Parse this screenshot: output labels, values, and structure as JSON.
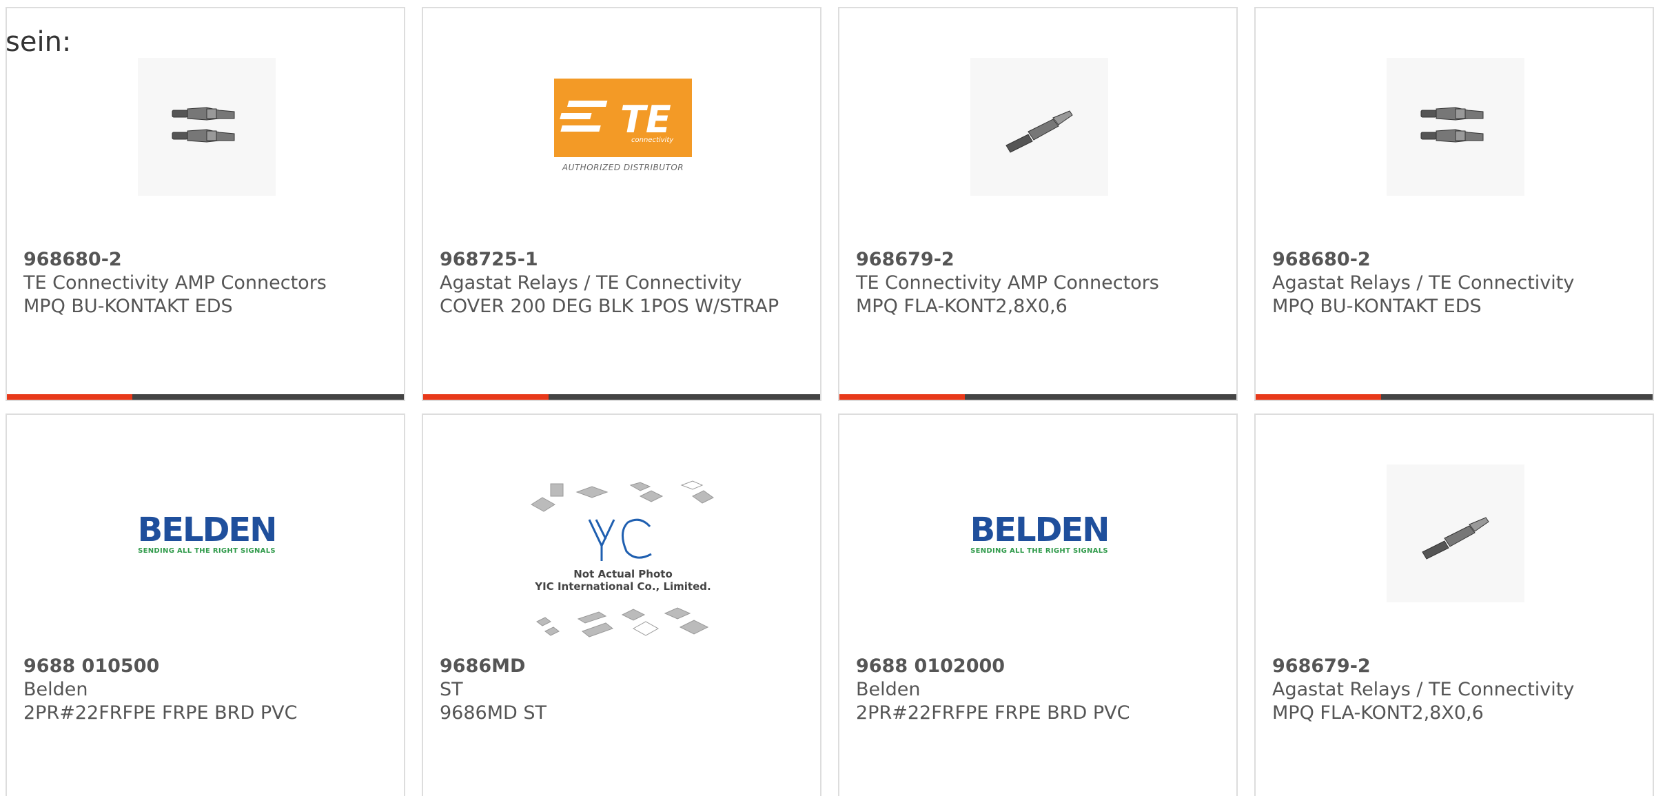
{
  "lead_text": "sein:",
  "colors": {
    "accent_red": "#e8391a",
    "bar_dark": "#444444",
    "te_orange": "#f39a26",
    "belden_blue": "#1f4f9c",
    "belden_green": "#2f9a4a"
  },
  "products": [
    {
      "part_number": "968680-2",
      "manufacturer": "TE Connectivity AMP Connectors",
      "description": "MPQ BU-KONTAKT EDS",
      "image": "socket-contact-photo"
    },
    {
      "part_number": "968725-1",
      "manufacturer": "Agastat Relays / TE Connectivity",
      "description": "COVER 200 DEG BLK 1POS W/STRAP",
      "image": "te-connectivity-logo",
      "logo_sub": "connectivity",
      "logo_caption": "AUTHORIZED DISTRIBUTOR"
    },
    {
      "part_number": "968679-2",
      "manufacturer": "TE Connectivity AMP Connectors",
      "description": "MPQ FLA-KONT2,8X0,6",
      "image": "flat-contact-photo"
    },
    {
      "part_number": "968680-2",
      "manufacturer": "Agastat Relays / TE Connectivity",
      "description": "MPQ BU-KONTAKT EDS",
      "image": "socket-contact-photo"
    },
    {
      "part_number": "9688 010500",
      "manufacturer": "Belden",
      "description": "2PR#22FRFPE FRPE BRD PVC",
      "image": "belden-logo",
      "logo_word": "BELDEN",
      "logo_tag": "SENDING ALL THE RIGHT SIGNALS"
    },
    {
      "part_number": "9686MD",
      "manufacturer": "ST",
      "description": "9686MD ST",
      "image": "yic-placeholder",
      "caption_line1": "Not Actual Photo",
      "caption_line2": "YIC International Co., Limited."
    },
    {
      "part_number": "9688 0102000",
      "manufacturer": "Belden",
      "description": "2PR#22FRFPE FRPE BRD PVC",
      "image": "belden-logo",
      "logo_word": "BELDEN",
      "logo_tag": "SENDING ALL THE RIGHT SIGNALS"
    },
    {
      "part_number": "968679-2",
      "manufacturer": "Agastat Relays / TE Connectivity",
      "description": "MPQ FLA-KONT2,8X0,6",
      "image": "flat-contact-photo"
    }
  ]
}
